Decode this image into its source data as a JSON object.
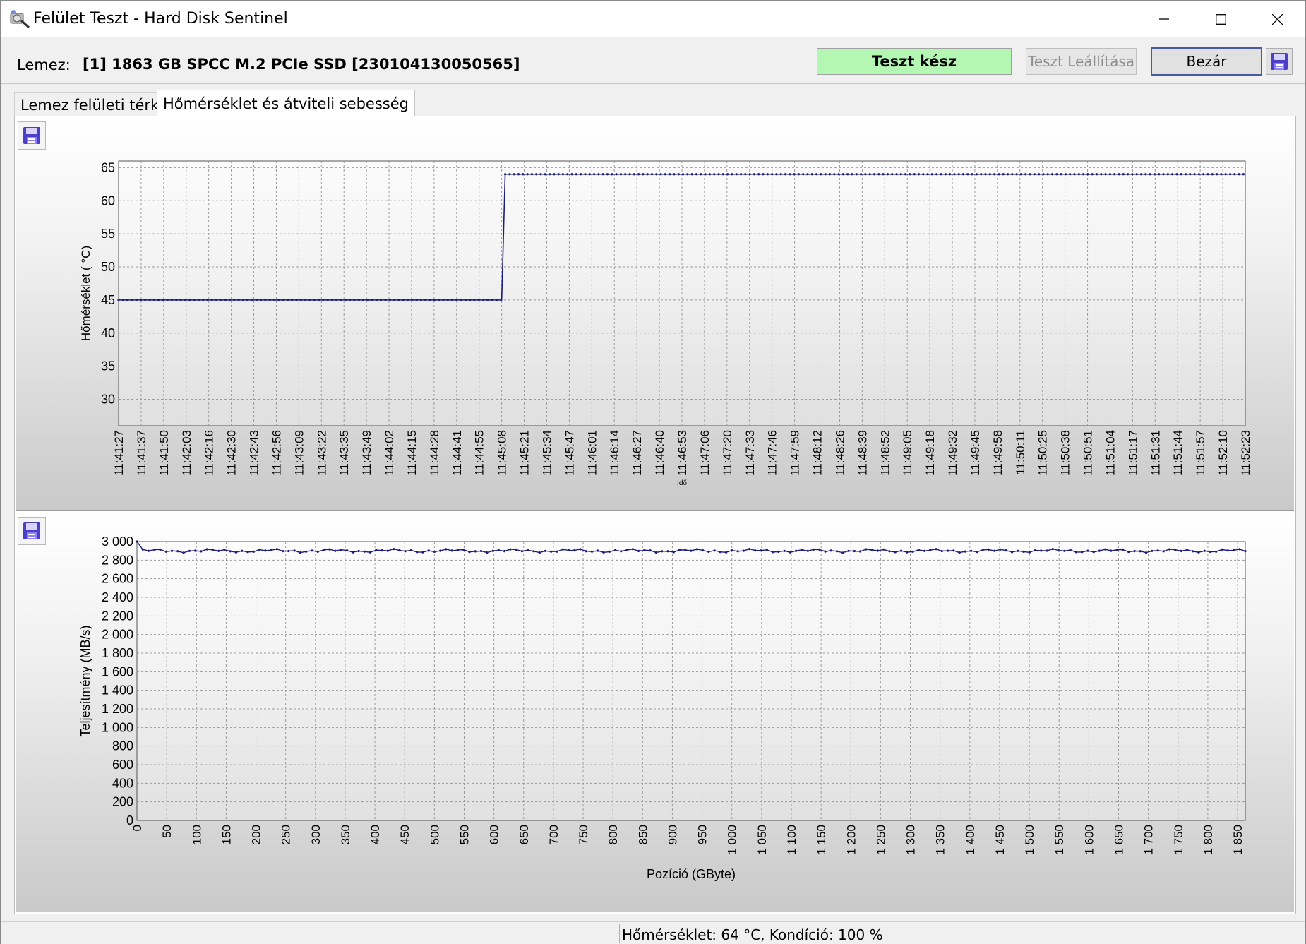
{
  "window": {
    "title": "Felület Teszt - Hard Disk Sentinel",
    "minimize_icon": "minimize-icon",
    "maximize_icon": "maximize-icon",
    "close_icon": "close-icon"
  },
  "header": {
    "disk_label": "Lemez:",
    "disk_value": "[1] 1863 GB  SPCC M.2 PCIe SSD [230104130050565]",
    "status_button": "Teszt kész",
    "status_color": "#b3f7b3",
    "stop_button": "Teszt Leállítása",
    "close_button": "Bezár",
    "save_icon": "floppy-disk-icon"
  },
  "tabs": [
    {
      "label": "Lemez felületi térkép",
      "active": false
    },
    {
      "label": "Hőmérséklet és átviteli sebesség",
      "active": true
    }
  ],
  "chart_data": [
    {
      "type": "line",
      "ylabel": "Hőmérséklet ( °C)",
      "xlabel": "Idő",
      "ylim": [
        26,
        66
      ],
      "yticks": [
        "30",
        "35",
        "40",
        "45",
        "50",
        "55",
        "60",
        "65"
      ],
      "x_tick_labels": [
        "11:41:27",
        "11:41:37",
        "11:41:50",
        "11:42:03",
        "11:42:16",
        "11:42:30",
        "11:42:43",
        "11:42:56",
        "11:43:09",
        "11:43:22",
        "11:43:35",
        "11:43:49",
        "11:44:02",
        "11:44:15",
        "11:44:28",
        "11:44:41",
        "11:44:55",
        "11:45:08",
        "11:45:21",
        "11:45:34",
        "11:45:47",
        "11:46:01",
        "11:46:14",
        "11:46:27",
        "11:46:40",
        "11:46:53",
        "11:47:06",
        "11:47:20",
        "11:47:33",
        "11:47:46",
        "11:47:59",
        "11:48:12",
        "11:48:26",
        "11:48:39",
        "11:48:52",
        "11:49:05",
        "11:49:18",
        "11:49:32",
        "11:49:45",
        "11:49:58",
        "11:50:11",
        "11:50:25",
        "11:50:38",
        "11:50:51",
        "11:51:04",
        "11:51:17",
        "11:51:31",
        "11:51:44",
        "11:51:57",
        "11:52:10",
        "11:52:23"
      ],
      "series": [
        {
          "color": "#1c1c7e",
          "segments": [
            {
              "from": "11:41:27",
              "to": "11:45:08",
              "value": 45
            },
            {
              "from": "11:45:10",
              "to": "11:52:23",
              "value": 64
            }
          ]
        }
      ],
      "grid": true
    },
    {
      "type": "line",
      "ylabel": "Teljesítmény (MB/s)",
      "xlabel": "Pozíció (GByte)",
      "ylim": [
        0,
        3000
      ],
      "yticks": [
        "0",
        "200",
        "400",
        "600",
        "800",
        "1 000",
        "1 200",
        "1 400",
        "1 600",
        "1 800",
        "2 000",
        "2 200",
        "2 400",
        "2 600",
        "2 800",
        "3 000"
      ],
      "x_tick_values": [
        0,
        50,
        100,
        150,
        200,
        250,
        300,
        350,
        400,
        450,
        500,
        550,
        600,
        650,
        700,
        750,
        800,
        850,
        900,
        950,
        1000,
        1050,
        1100,
        1150,
        1200,
        1250,
        1300,
        1350,
        1400,
        1450,
        1500,
        1550,
        1600,
        1650,
        1700,
        1750,
        1800,
        1850
      ],
      "x_tick_labels": [
        "0",
        "50",
        "100",
        "150",
        "200",
        "250",
        "300",
        "350",
        "400",
        "450",
        "500",
        "550",
        "600",
        "650",
        "700",
        "750",
        "800",
        "850",
        "900",
        "950",
        "1 000",
        "1 050",
        "1 100",
        "1 150",
        "1 200",
        "1 250",
        "1 300",
        "1 350",
        "1 400",
        "1 450",
        "1 500",
        "1 550",
        "1 600",
        "1 650",
        "1 700",
        "1 750",
        "1 800",
        "1 850"
      ],
      "xlim": [
        0,
        1863
      ],
      "series": [
        {
          "color": "#1c1c7e",
          "approx_value": 2900,
          "start_value": 3000,
          "range": [
            2880,
            2920
          ]
        }
      ],
      "grid": true
    }
  ],
  "statusbar": {
    "text": "Hőmérséklet: 64  °C,  Kondíció: 100 %"
  }
}
